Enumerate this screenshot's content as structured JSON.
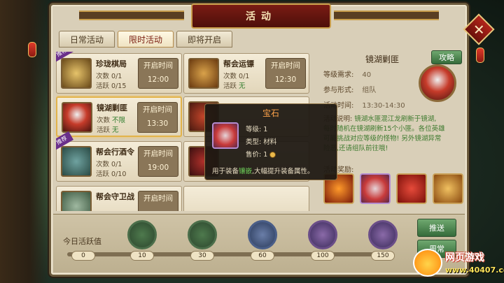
{
  "window": {
    "title": "活动"
  },
  "tabs": [
    {
      "label": "日常活动",
      "active": false
    },
    {
      "label": "限时活动",
      "active": true
    },
    {
      "label": "即将开启",
      "active": false
    }
  ],
  "activities": [
    {
      "name": "珍珑棋局",
      "count_label": "次数",
      "count": "0/1",
      "active_label": "活跃",
      "active_val": "0/15",
      "time_label": "开启时间",
      "time": "12:00",
      "badge": "推荐",
      "selected": false
    },
    {
      "name": "镜湖剿匪",
      "count_label": "次数",
      "count": "不限",
      "active_label": "活跃",
      "active_val": "无",
      "time_label": "开启时间",
      "time": "13:30",
      "badge": "",
      "selected": true
    },
    {
      "name": "帮会行酒令",
      "count_label": "次数",
      "count": "0/1",
      "active_label": "活跃",
      "active_val": "0/10",
      "time_label": "开启时间",
      "time": "19:00",
      "badge": "推荐",
      "selected": false
    },
    {
      "name": "帮会守卫战",
      "count_label": "",
      "count": "",
      "active_label": "",
      "active_val": "",
      "time_label": "开启时间",
      "time": "",
      "badge": "",
      "selected": false
    }
  ],
  "activities_mid": [
    {
      "name": "帮会运镖",
      "count_label": "次数",
      "count": "0/1",
      "active_label": "活跃",
      "active_val": "无",
      "time_label": "开启时间",
      "time": "12:30"
    }
  ],
  "detail": {
    "title": "镜湖剿匪",
    "raid_button": "攻略",
    "level_label": "等级需求:",
    "level": "40",
    "mode_label": "参与形式:",
    "mode": "组队",
    "time_label": "活动时间:",
    "time": "13:30-14:30",
    "desc_label": "活动说明:",
    "desc_1": "镜湖水匪混江龙刷新于镜湖,",
    "desc_2": "每时随机在镜湖刷新15个小匪。各位英雄",
    "desc_3": "可能挑战对应等级的怪物! 另外镜湖异常",
    "desc_4": "险恶,还请组队前往哦!",
    "reward_label": "活动奖励:",
    "rewards": [
      "exp-scroll-icon",
      "gem-icon",
      "red-envelope-icon",
      "scroll-icon"
    ]
  },
  "tooltip": {
    "title": "宝石",
    "level_label": "等级:",
    "level": "1",
    "type_label": "类型:",
    "type": "材料",
    "price_label": "售价:",
    "price": "1",
    "desc_pre": "用于装备",
    "desc_hl": "镶嵌",
    "desc_post": ",大幅提升装备属性。"
  },
  "activity_bar": {
    "label": "今日活跃值",
    "values": [
      "0",
      "10",
      "30",
      "60",
      "100",
      "150"
    ],
    "push_button": "推送",
    "daily_button": "周常"
  },
  "watermark": {
    "brand": "网页游戏",
    "site": "www.40407.com"
  }
}
